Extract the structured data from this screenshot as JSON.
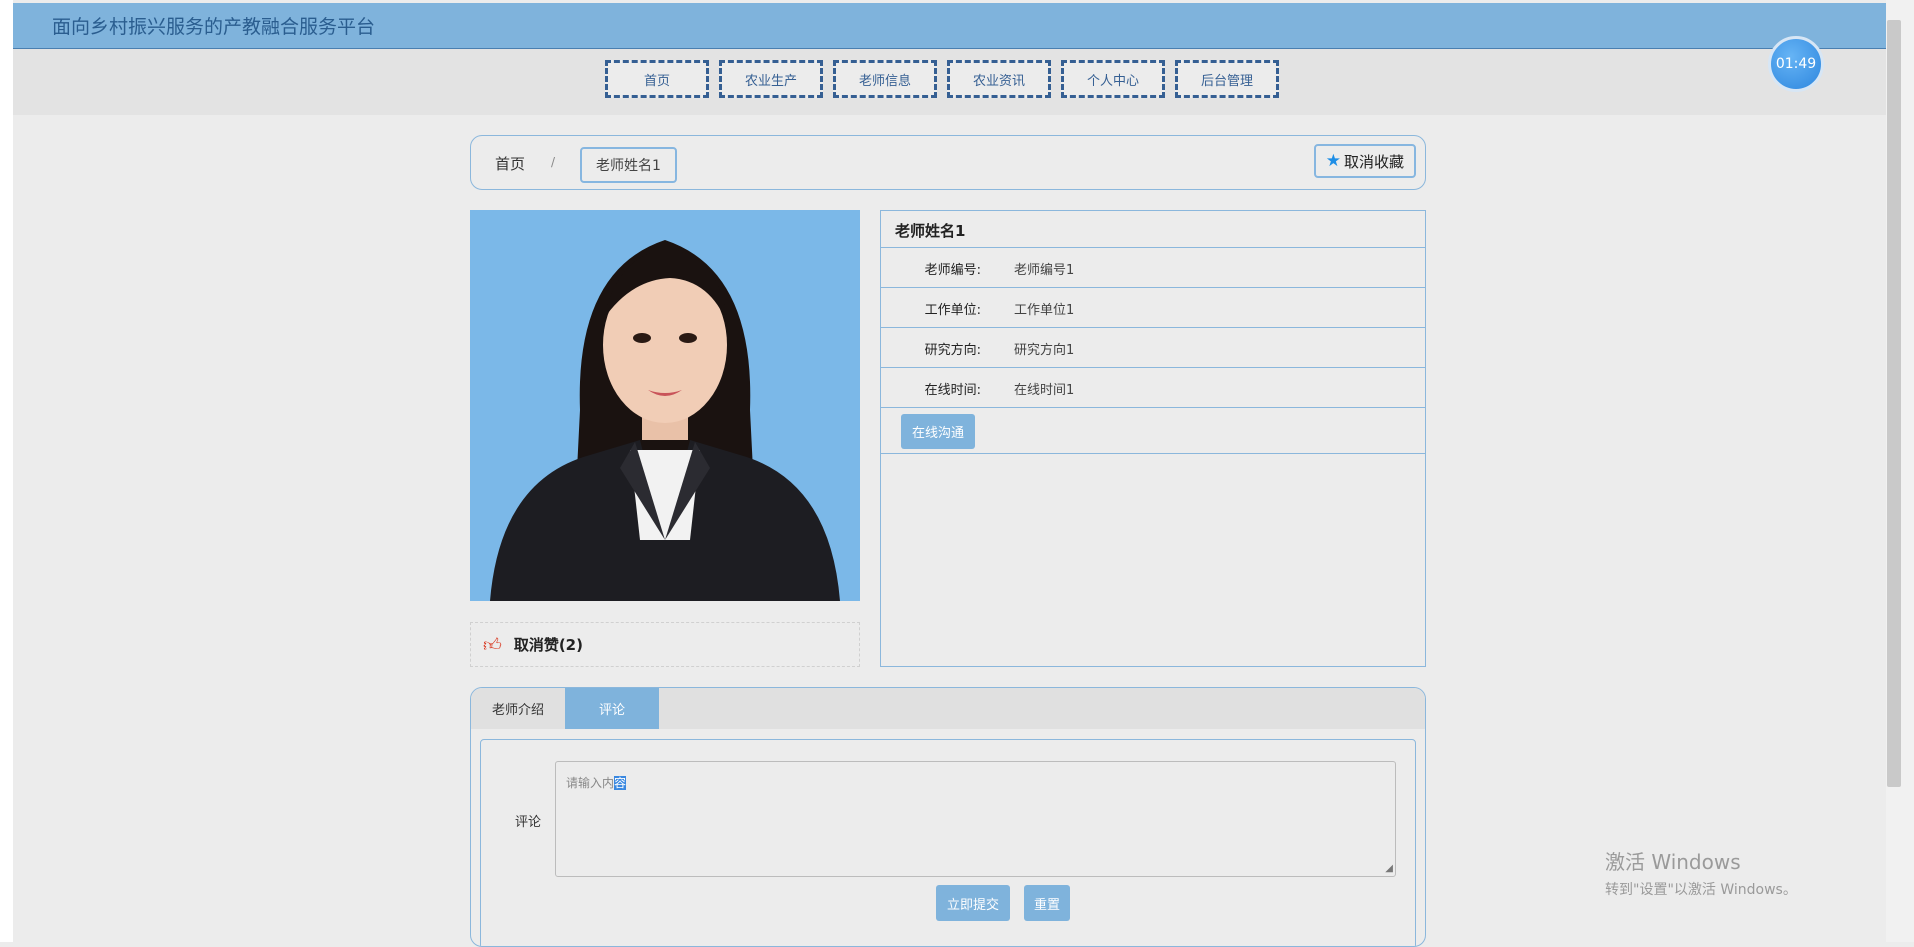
{
  "header": {
    "title": "面向乡村振兴服务的产教融合服务平台"
  },
  "nav": {
    "items": [
      {
        "label": "首页"
      },
      {
        "label": "农业生产"
      },
      {
        "label": "老师信息"
      },
      {
        "label": "农业资讯"
      },
      {
        "label": "个人中心"
      },
      {
        "label": "后台管理"
      }
    ]
  },
  "clock": {
    "time": "01:49"
  },
  "breadcrumb": {
    "home": "首页",
    "separator": "/",
    "current": "老师姓名1"
  },
  "favorite": {
    "label": "取消收藏"
  },
  "likes": {
    "label": "取消赞(2)"
  },
  "teacher": {
    "name": "老师姓名1",
    "fields": [
      {
        "label": "老师编号:",
        "value": "老师编号1"
      },
      {
        "label": "工作单位:",
        "value": "工作单位1"
      },
      {
        "label": "研究方向:",
        "value": "研究方向1"
      },
      {
        "label": "在线时间:",
        "value": "在线时间1"
      }
    ],
    "chat_label": "在线沟通"
  },
  "tabs": [
    {
      "label": "老师介绍"
    },
    {
      "label": "评论"
    }
  ],
  "comment": {
    "label": "评论",
    "placeholder_prefix": "请输入内",
    "placeholder_selected": "容",
    "submit_label": "立即提交",
    "reset_label": "重置"
  },
  "watermark": {
    "line1": "激活 Windows",
    "line2": "转到\"设置\"以激活 Windows。"
  },
  "colors": {
    "accent": "#7fb3dc",
    "nav_border": "#355f93",
    "like": "#d8341c"
  }
}
